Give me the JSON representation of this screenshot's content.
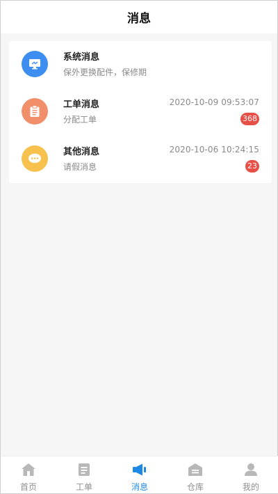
{
  "header": {
    "title": "消息"
  },
  "messages": [
    {
      "title": "系统消息",
      "subtitle": "保外更换配件，保修期",
      "time": "",
      "badge": "",
      "icon": "monitor-icon",
      "color": "#3d8ef0"
    },
    {
      "title": "工单消息",
      "subtitle": "分配工单",
      "time": "2020-10-09 09:53:07",
      "badge": "368",
      "icon": "clipboard-icon",
      "color": "#f08f6a"
    },
    {
      "title": "其他消息",
      "subtitle": "请假消息",
      "time": "2020-10-06 10:24:15",
      "badge": "23",
      "icon": "chat-bubble-icon",
      "color": "#f7c14e"
    }
  ],
  "tabs": [
    {
      "label": "首页",
      "icon": "home-icon"
    },
    {
      "label": "工单",
      "icon": "document-icon"
    },
    {
      "label": "消息",
      "icon": "megaphone-icon",
      "active": true
    },
    {
      "label": "仓库",
      "icon": "warehouse-icon"
    },
    {
      "label": "我的",
      "icon": "person-icon"
    }
  ],
  "colors": {
    "accent": "#1e88e5",
    "badge": "#e84f47",
    "tab_inactive": "#b8b8b8"
  }
}
